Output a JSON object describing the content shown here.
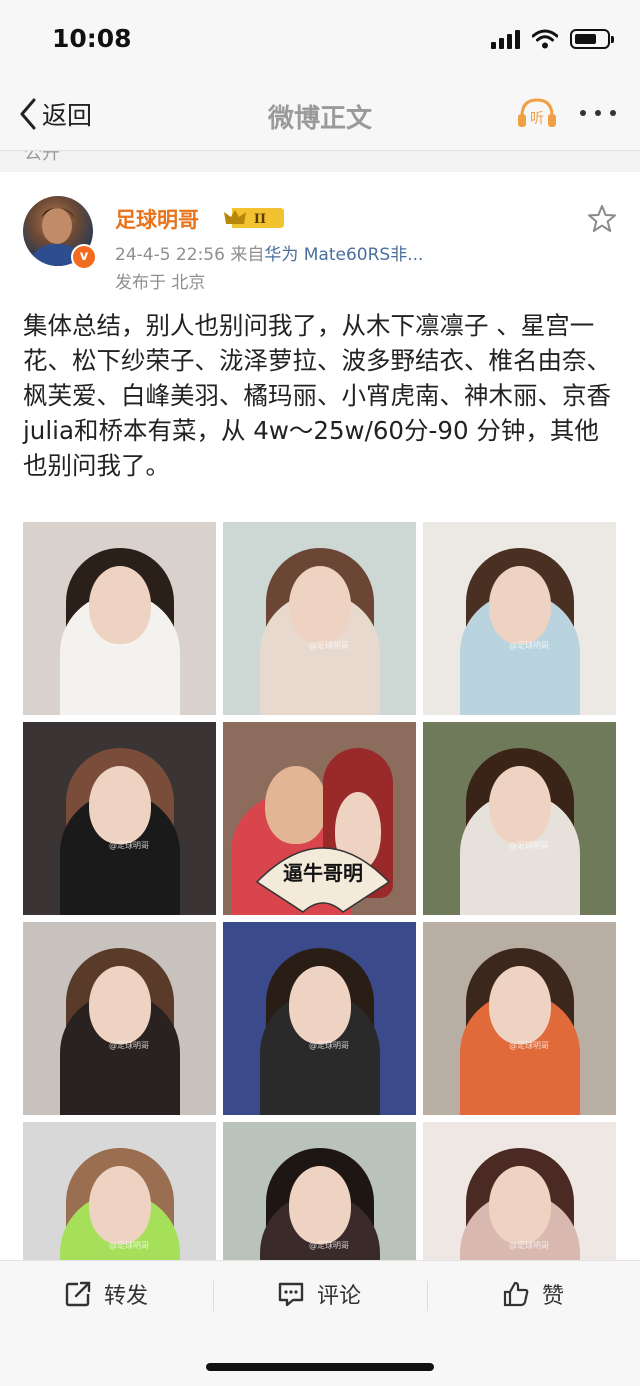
{
  "status_bar": {
    "time": "10:08",
    "battery_level": 0.7
  },
  "nav": {
    "back_label": "返回",
    "title": "微博正文",
    "listen_label": "听"
  },
  "peek_text": "公开",
  "post": {
    "author": "足球明哥",
    "badge": "II",
    "timestamp": "24-4-5 22:56",
    "source_prefix": "来自",
    "device": "华为 Mate60RS非...",
    "location": "发布于 北京",
    "text": "集体总结，别人也别问我了，从木下凛凛子 、星宫一花、松下纱荣子、泷泽萝拉、波多野结衣、椎名由奈、枫芙爱、白峰美羽、橘玛丽、小宵虎南、神木丽、京香 julia和桥本有菜，从 4w～25w/60分-90 分钟，其他也别问我了。",
    "fan_text": "逼牛哥明",
    "watermark": "@足球明哥"
  },
  "colors": {
    "accent": "#e8731b",
    "link": "#4a6f9d",
    "verify": "#f26b21",
    "badge_gold": "#f2c230"
  },
  "actions": {
    "repost": "转发",
    "comment": "评论",
    "like": "赞"
  }
}
